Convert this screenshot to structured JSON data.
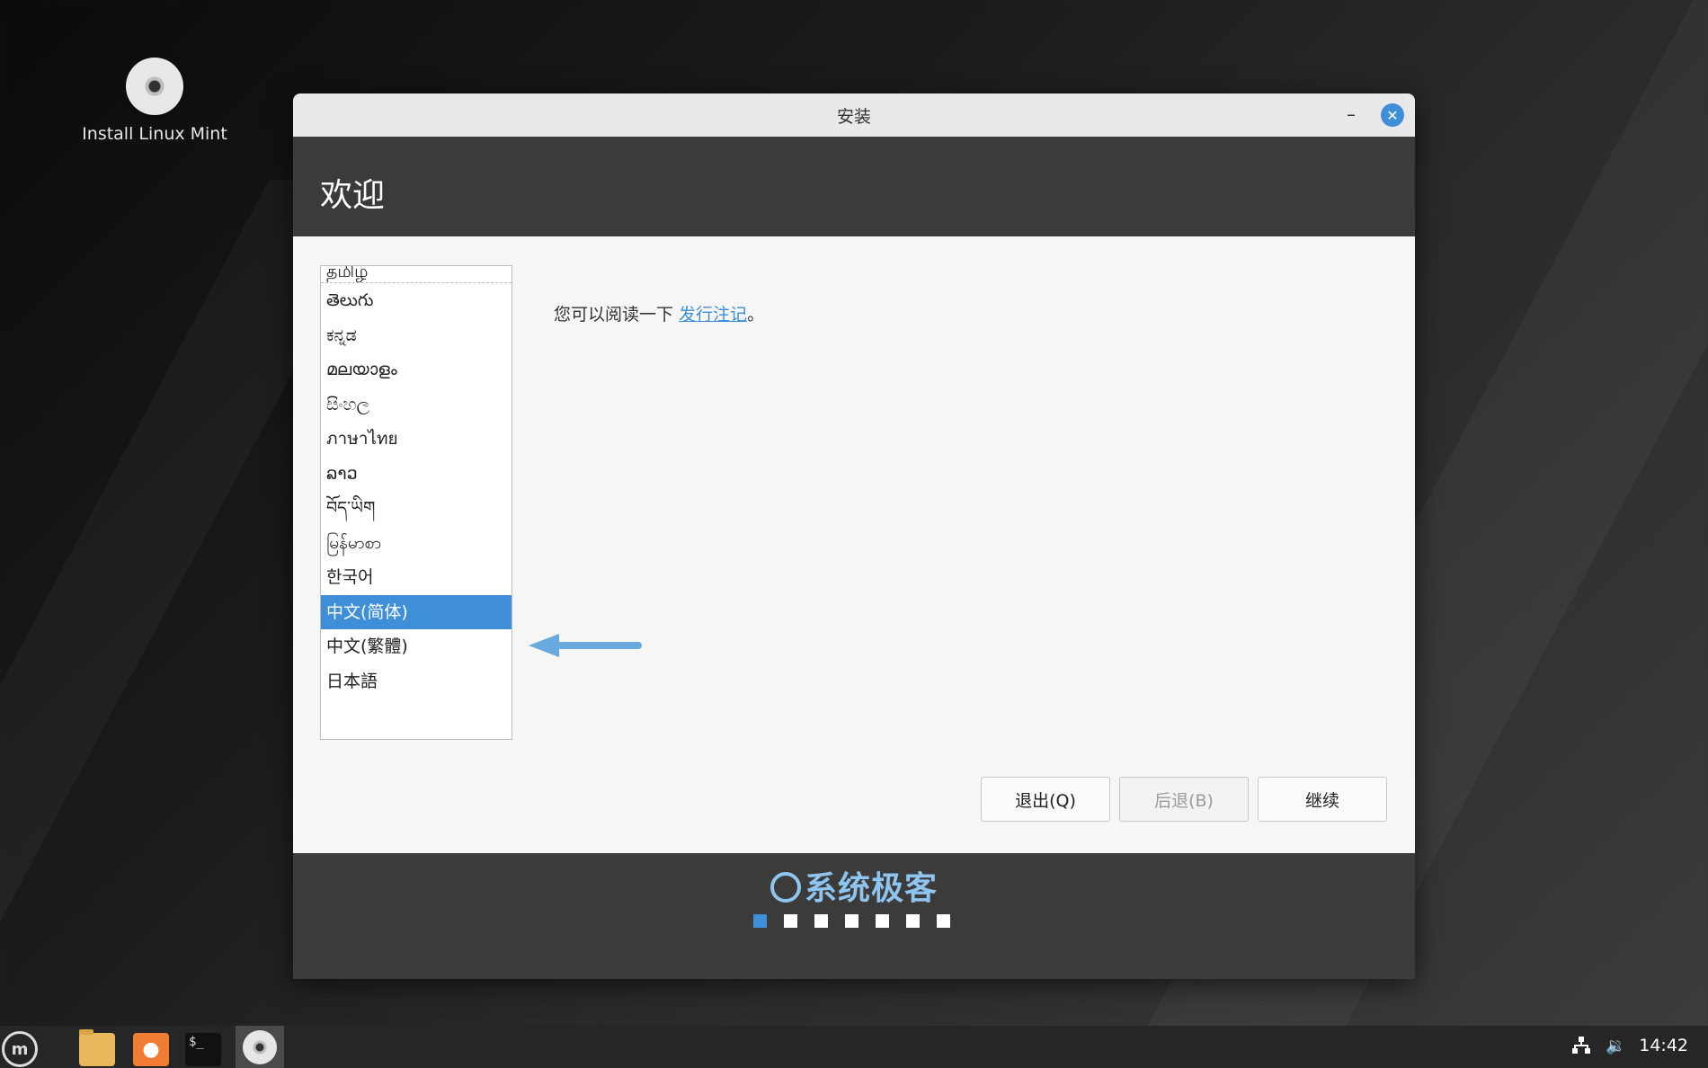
{
  "desktop": {
    "icon_label": "Install Linux Mint",
    "icon_name": "disc-icon"
  },
  "window": {
    "title": "安装",
    "header_title": "欢迎",
    "minimize_label": "–",
    "close_label": "✕",
    "languages": [
      {
        "label": "தமிழ்",
        "partial": true
      },
      {
        "label": "తెలుగు"
      },
      {
        "label": "ಕನ್ನಡ"
      },
      {
        "label": "മലയാളം"
      },
      {
        "label": "සිංහල"
      },
      {
        "label": "ภาษาไทย"
      },
      {
        "label": "ລາວ"
      },
      {
        "label": "བོད་ཡིག"
      },
      {
        "label": "မြန်မာစာ"
      },
      {
        "label": "한국어"
      },
      {
        "label": "中文(简体)",
        "selected": true
      },
      {
        "label": "中文(繁體)"
      },
      {
        "label": "日本語"
      }
    ],
    "release_notes": {
      "prefix": "您可以阅读一下 ",
      "link": "发行注记",
      "suffix": "。"
    },
    "buttons": {
      "quit": "退出(Q)",
      "back": "后退(B)",
      "continue": "继续"
    },
    "footer": {
      "watermark": "系统极客",
      "progress_steps": 7,
      "current_step": 1
    }
  },
  "taskbar": {
    "clock": "14:42",
    "apps": [
      "file-manager-icon",
      "firefox-icon",
      "terminal-icon",
      "installer-disc-icon"
    ]
  },
  "colors": {
    "accent": "#3f8fd8",
    "header_bg": "#3b3b3b",
    "content_bg": "#f6f6f6",
    "titlebar_bg": "#e9e9e9"
  }
}
